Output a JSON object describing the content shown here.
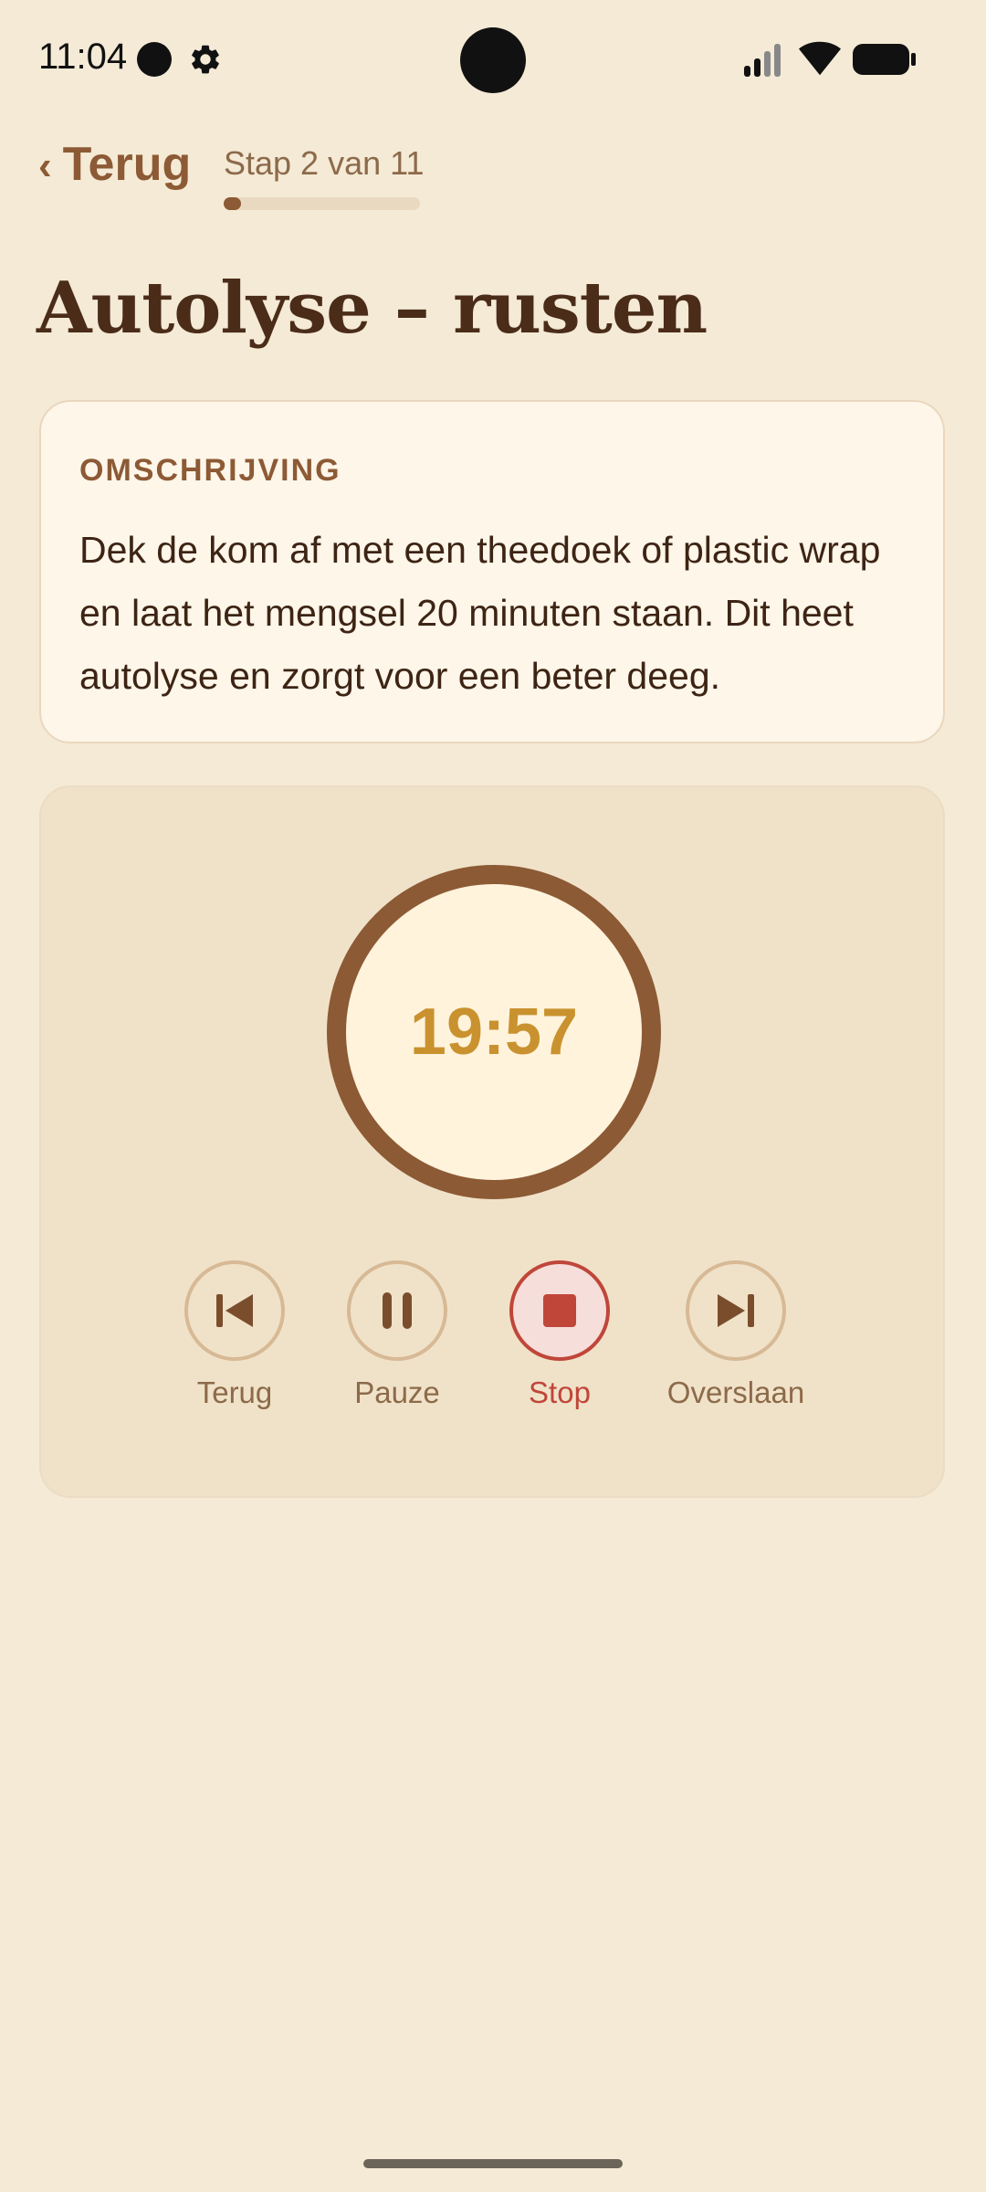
{
  "status_bar": {
    "time": "11:04"
  },
  "header": {
    "back_label": "Terug",
    "step_label": "Stap 2 van 11",
    "progress": 0.09
  },
  "page_title": "Autolyse – rusten",
  "description": {
    "heading": "OMSCHRIJVING",
    "text": "Dek de kom af met een theedoek of plastic wrap en laat het mengsel 20 minuten staan. Dit heet autolyse en zorgt voor een beter deeg."
  },
  "timer": {
    "value": "19:57"
  },
  "controls": {
    "previous_label": "Terug",
    "pause_label": "Pauze",
    "stop_label": "Stop",
    "skip_label": "Overslaan"
  },
  "colors": {
    "background": "#F4EAD6",
    "accent_brown": "#8C5A35",
    "timer_text": "#C9922F",
    "stop_red": "#C0463A"
  },
  "icons": [
    "settings-icon",
    "signal-icon",
    "wifi-icon",
    "battery-icon",
    "skip-previous-icon",
    "pause-icon",
    "stop-icon",
    "skip-next-icon"
  ]
}
